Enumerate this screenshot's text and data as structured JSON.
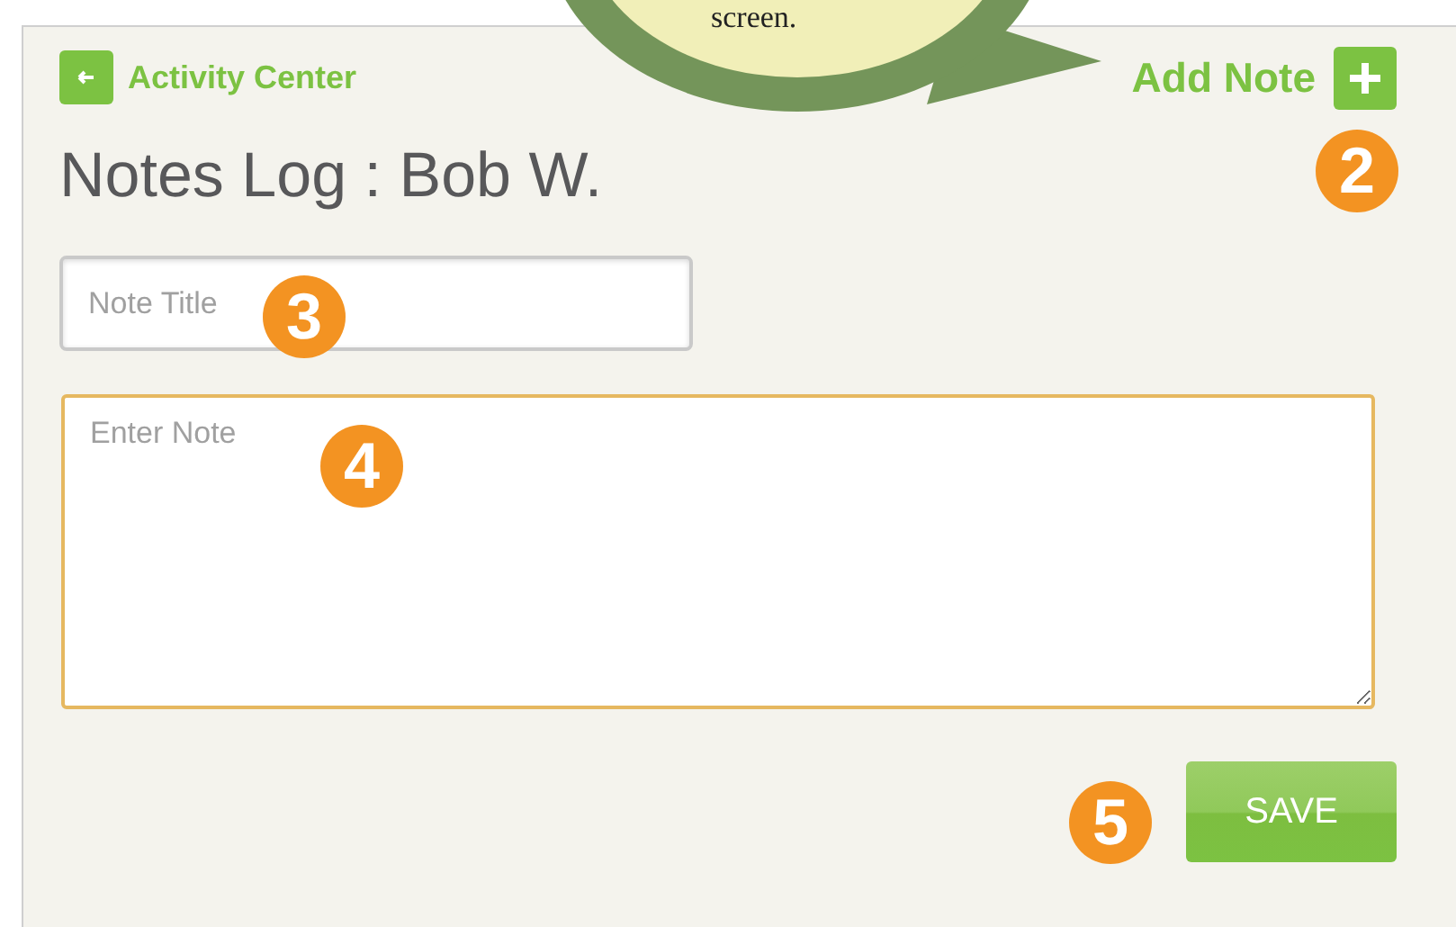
{
  "callout": {
    "text": "screen."
  },
  "header": {
    "back_label": "Activity Center",
    "add_label": "Add Note"
  },
  "title": "Notes Log : Bob W.",
  "note_title": {
    "placeholder": "Note Title"
  },
  "note_body": {
    "placeholder": "Enter Note"
  },
  "save_button": "SAVE",
  "badges": [
    "2",
    "3",
    "4",
    "5"
  ]
}
